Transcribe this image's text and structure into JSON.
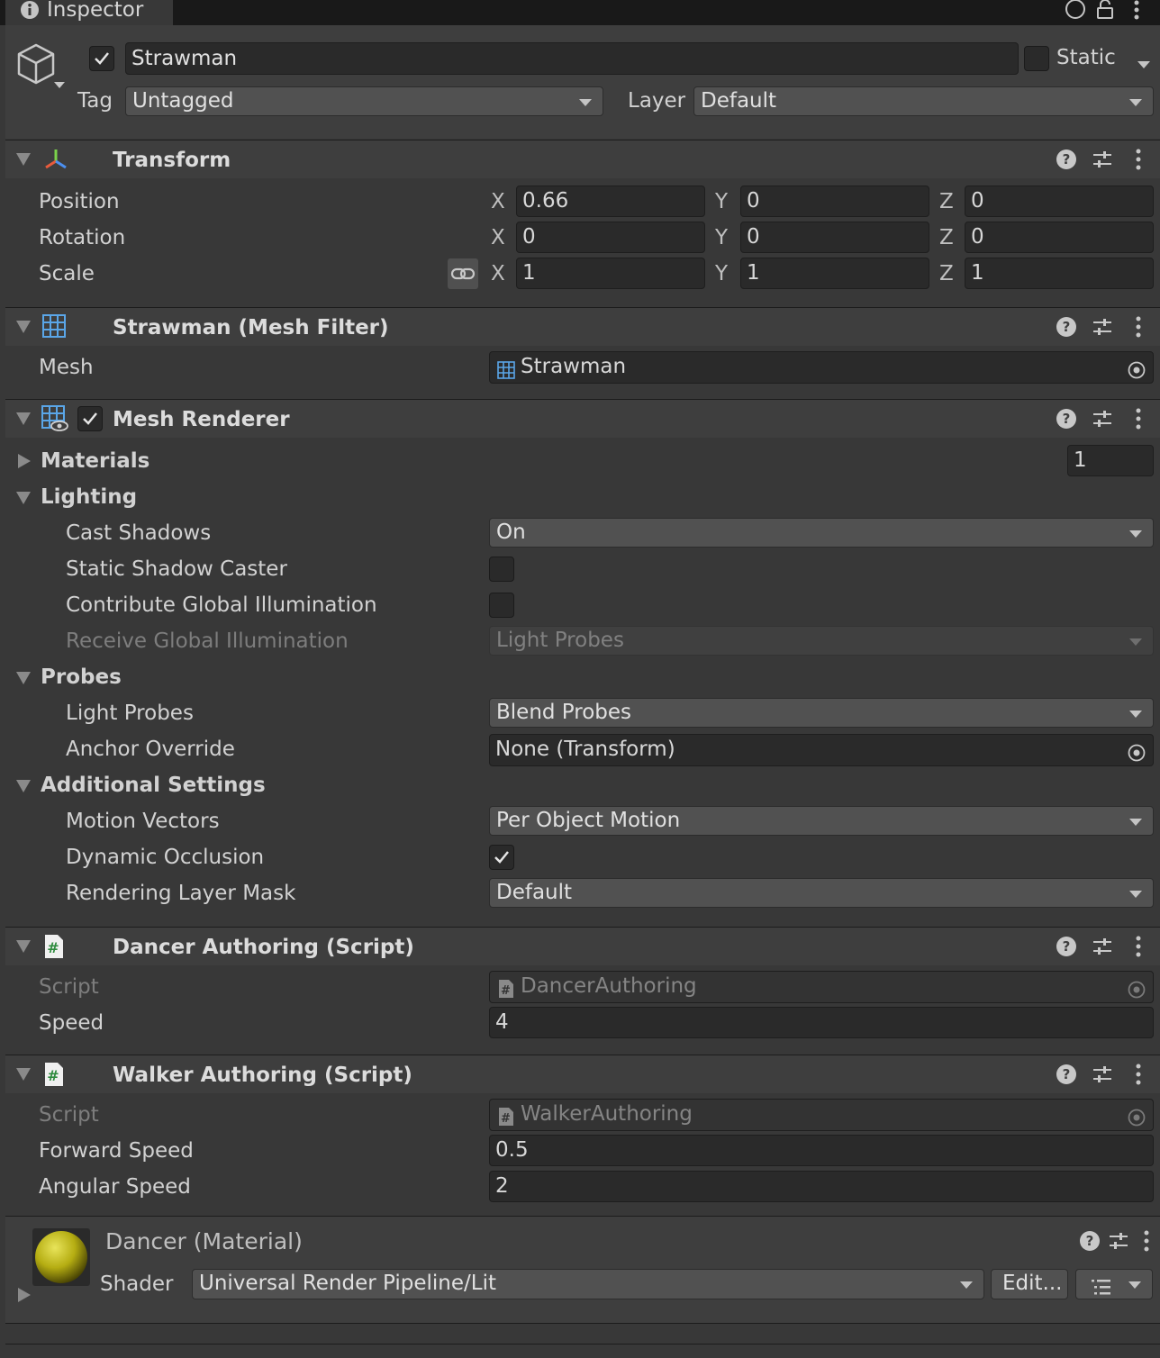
{
  "tab": {
    "title": "Inspector"
  },
  "gameobject": {
    "active": true,
    "name": "Strawman",
    "static_label": "Static",
    "tag_label": "Tag",
    "tag_value": "Untagged",
    "layer_label": "Layer",
    "layer_value": "Default"
  },
  "transform": {
    "title": "Transform",
    "rows": [
      {
        "label": "Position",
        "x": "0.66",
        "y": "0",
        "z": "0"
      },
      {
        "label": "Rotation",
        "x": "0",
        "y": "0",
        "z": "0"
      },
      {
        "label": "Scale",
        "x": "1",
        "y": "1",
        "z": "1"
      }
    ],
    "axis_x": "X",
    "axis_y": "Y",
    "axis_z": "Z"
  },
  "mesh_filter": {
    "title": "Strawman (Mesh Filter)",
    "mesh_label": "Mesh",
    "mesh_value": "Strawman"
  },
  "mesh_renderer": {
    "title": "Mesh Renderer",
    "enabled": true,
    "materials_label": "Materials",
    "materials_count": "1",
    "lighting_label": "Lighting",
    "cast_shadows_label": "Cast Shadows",
    "cast_shadows_value": "On",
    "static_shadow_label": "Static Shadow Caster",
    "static_shadow_checked": false,
    "contribute_gi_label": "Contribute Global Illumination",
    "contribute_gi_checked": false,
    "receive_gi_label": "Receive Global Illumination",
    "receive_gi_value": "Light Probes",
    "probes_label": "Probes",
    "light_probes_label": "Light Probes",
    "light_probes_value": "Blend Probes",
    "anchor_override_label": "Anchor Override",
    "anchor_override_value": "None (Transform)",
    "additional_label": "Additional Settings",
    "motion_vectors_label": "Motion Vectors",
    "motion_vectors_value": "Per Object Motion",
    "dynamic_occlusion_label": "Dynamic Occlusion",
    "dynamic_occlusion_checked": true,
    "rendering_layer_label": "Rendering Layer Mask",
    "rendering_layer_value": "Default"
  },
  "dancer": {
    "title": "Dancer Authoring (Script)",
    "script_label": "Script",
    "script_value": "DancerAuthoring",
    "speed_label": "Speed",
    "speed_value": "4"
  },
  "walker": {
    "title": "Walker Authoring (Script)",
    "script_label": "Script",
    "script_value": "WalkerAuthoring",
    "forward_label": "Forward Speed",
    "forward_value": "0.5",
    "angular_label": "Angular Speed",
    "angular_value": "2"
  },
  "material": {
    "title": "Dancer (Material)",
    "shader_label": "Shader",
    "shader_value": "Universal Render Pipeline/Lit",
    "edit_label": "Edit...",
    "preview_color": "#c8c21a"
  },
  "colors": {
    "background": "#383838",
    "header": "#3e3e3e",
    "field": "#2a2a2a",
    "dropdown": "#515151"
  }
}
